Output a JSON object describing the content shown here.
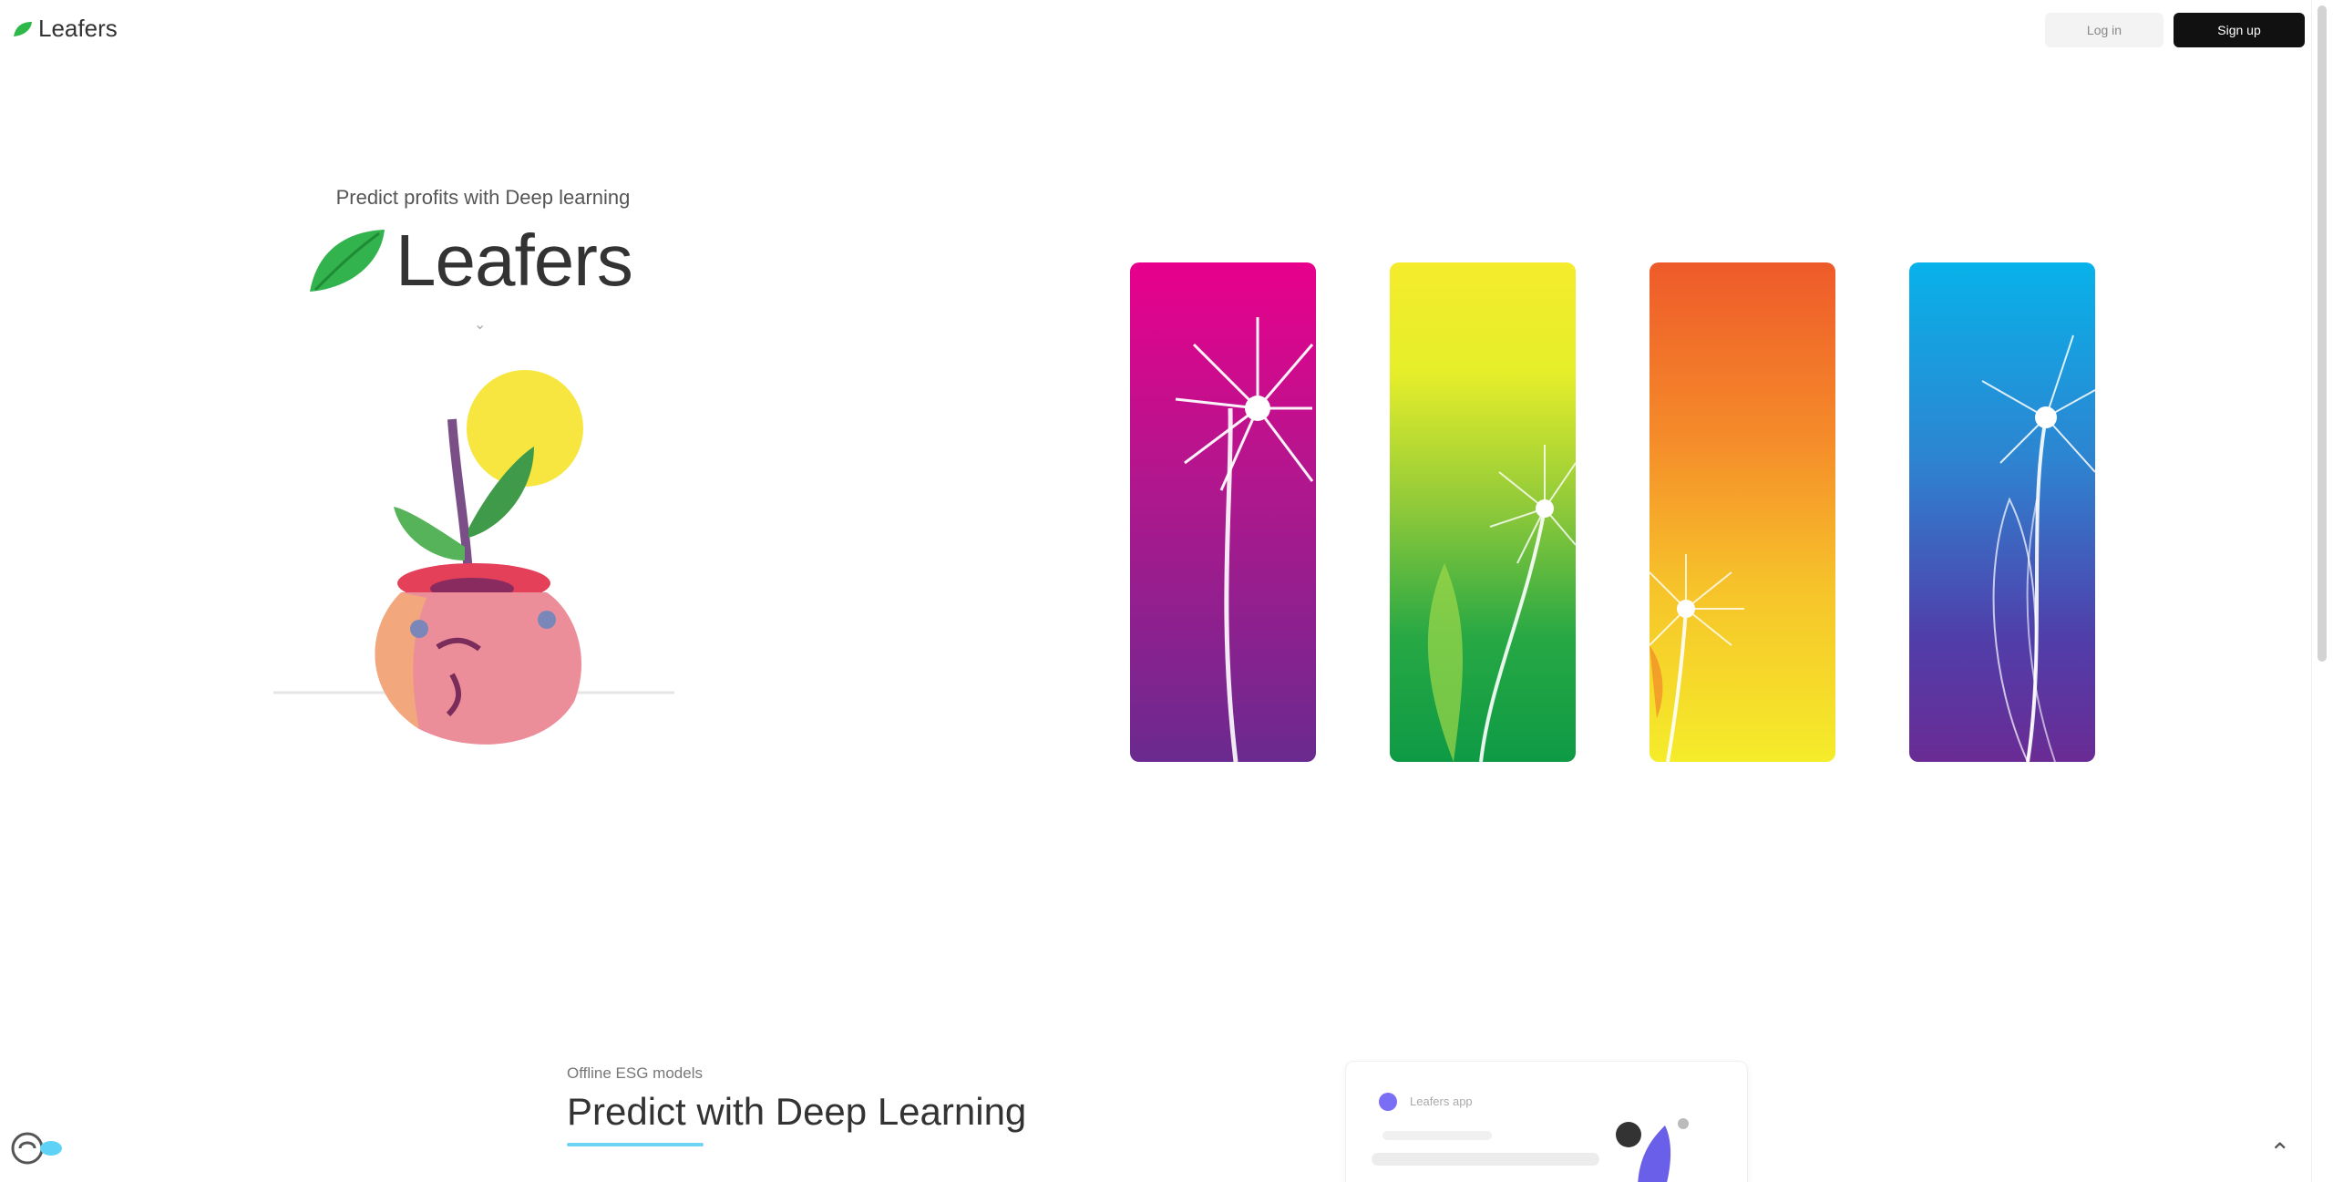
{
  "header": {
    "brand": "Leafers",
    "login_label": "Log in",
    "signup_label": "Sign up"
  },
  "hero": {
    "tagline": "Predict profits with Deep learning",
    "logo_word": "Leafers"
  },
  "cards": [
    {
      "name": "magenta-dandelion",
      "colors": [
        "#e8008c",
        "#6a2a8f"
      ]
    },
    {
      "name": "yellow-green-dandelion",
      "colors": [
        "#f4ec2c",
        "#0e9a45"
      ]
    },
    {
      "name": "orange-yellow-dandelion",
      "colors": [
        "#ee5a2a",
        "#f5ec2a"
      ]
    },
    {
      "name": "blue-purple-dandelion",
      "colors": [
        "#08b2ea",
        "#6a2b94"
      ]
    }
  ],
  "section": {
    "eyebrow": "Offline ESG models",
    "heading": "Predict with Deep Learning",
    "preview_caption": "Leafers app"
  },
  "icons": {
    "brand": "leaf-icon",
    "down": "chevron-down-icon",
    "help": "chat-help-icon",
    "scroll_top": "chevron-up-icon"
  },
  "colors": {
    "accent": "#6fd3f5",
    "leaf_green": "#2fb84a",
    "dark": "#111111"
  }
}
